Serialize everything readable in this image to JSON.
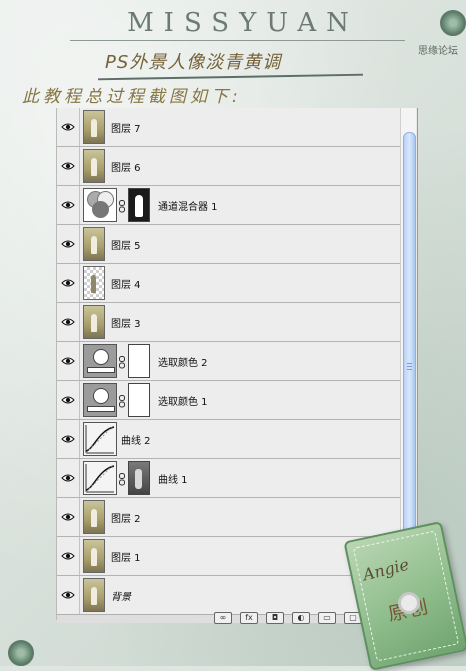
{
  "banner": {
    "title": "MISSYUAN",
    "subtitle": "思缘论坛"
  },
  "tutorial": {
    "title": "PS外景人像淡青黄调",
    "intro": "此教程总过程截图如下:"
  },
  "layers_panel": {
    "layers": [
      {
        "name": "图层 7",
        "kind": "pixel",
        "thumb_icon": "photo-thumb"
      },
      {
        "name": "图层 6",
        "kind": "pixel",
        "thumb_icon": "photo-thumb"
      },
      {
        "name": "通道混合器 1",
        "kind": "adjustment",
        "thumb_icon": "channel-mixer-icon",
        "mask": "dark"
      },
      {
        "name": "图层 5",
        "kind": "pixel",
        "thumb_icon": "photo-thumb"
      },
      {
        "name": "图层 4",
        "kind": "pixel-transparent",
        "thumb_icon": "transparent-thumb"
      },
      {
        "name": "图层 3",
        "kind": "pixel",
        "thumb_icon": "photo-thumb"
      },
      {
        "name": "选取颜色 2",
        "kind": "adjustment",
        "thumb_icon": "selective-color-icon",
        "mask": "white"
      },
      {
        "name": "选取颜色 1",
        "kind": "adjustment",
        "thumb_icon": "selective-color-icon",
        "mask": "white"
      },
      {
        "name": "曲线 2",
        "kind": "adjustment-nomask",
        "thumb_icon": "curves-icon"
      },
      {
        "name": "曲线 1",
        "kind": "adjustment",
        "thumb_icon": "curves-icon",
        "mask": "grey"
      },
      {
        "name": "图层 2",
        "kind": "pixel",
        "thumb_icon": "photo-thumb"
      },
      {
        "name": "图层 1",
        "kind": "pixel",
        "thumb_icon": "photo-thumb"
      },
      {
        "name": "背景",
        "kind": "background",
        "thumb_icon": "photo-thumb",
        "locked": true
      }
    ],
    "footer_icons": [
      "link-icon",
      "fx-icon",
      "mask-icon",
      "adjustment-icon",
      "group-icon",
      "new-layer-icon",
      "delete-icon"
    ]
  },
  "stamp": {
    "label": "原创",
    "signature": "Angie"
  },
  "colors": {
    "accent_gold": "#76623b",
    "scroll_blue": "#b8d2f5",
    "tag_green": "#8fbd8c"
  }
}
